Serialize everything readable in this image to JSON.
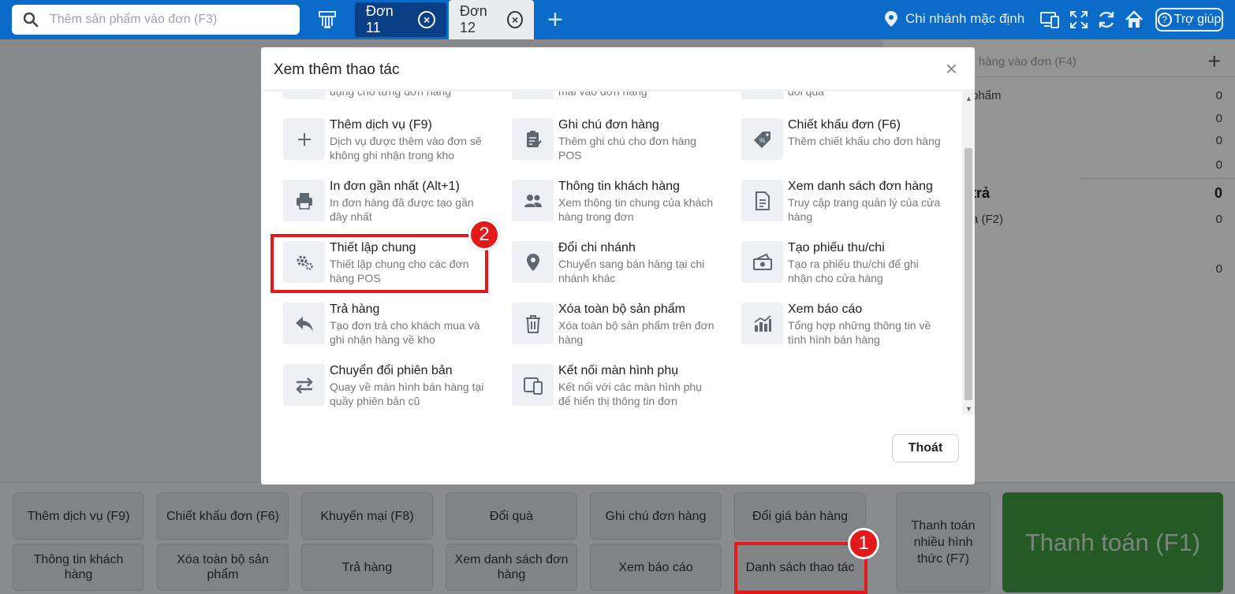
{
  "topbar": {
    "search_placeholder": "Thêm sản phẩm vào đơn (F3)",
    "tabs": [
      {
        "label": "Đơn 11"
      },
      {
        "label": "Đơn 12"
      }
    ],
    "add_tab": "+",
    "branch": "Chi nhánh mặc định",
    "help": "Trợ giúp",
    "icons": [
      "search-icon",
      "barcode-icon",
      "close-icon",
      "plus-icon",
      "location-pin-icon",
      "devices-icon",
      "fullscreen-icon",
      "refresh-icon",
      "home-icon",
      "help-icon"
    ]
  },
  "right_panel": {
    "customer_placeholder": "nh hàng vào đơn (F4)",
    "plus": "+",
    "rows": [
      {
        "label": "phẩm",
        "value": "0"
      },
      {
        "label": "",
        "value": "0"
      },
      {
        "label": "",
        "value": "0"
      },
      {
        "label": ")",
        "value": "0"
      },
      {
        "label": "trả",
        "value": "0"
      },
      {
        "label": "a (F2)",
        "value": "0"
      },
      {
        "label": "",
        "value": "0"
      }
    ]
  },
  "modal": {
    "title": "Xem thêm thao tác",
    "close": "×",
    "cutoff_descriptions": [
      "dụng cho từng đơn hàng",
      "mãi vào đơn hàng",
      "đổi quà"
    ],
    "actions": [
      {
        "title": "Thêm dịch vụ (F9)",
        "desc": "Dịch vụ được thêm vào đơn sẽ không ghi nhận trong kho",
        "icon": "plus-icon"
      },
      {
        "title": "Ghi chú đơn hàng",
        "desc": "Thêm ghi chú cho đơn hàng POS",
        "icon": "clipboard-note-icon"
      },
      {
        "title": "Chiết khấu đơn (F6)",
        "desc": "Thêm chiết khấu cho đơn hàng",
        "icon": "discount-tag-icon"
      },
      {
        "title": "In đơn gần nhất (Alt+1)",
        "desc": "In đơn hàng đã được tạo gần đây nhất",
        "icon": "printer-icon"
      },
      {
        "title": "Thông tin khách hàng",
        "desc": "Xem thông tin chung của khách hàng trong đơn",
        "icon": "users-icon"
      },
      {
        "title": "Xem danh sách đơn hàng",
        "desc": "Truy cập trang quản lý của cửa hàng",
        "icon": "document-list-icon"
      },
      {
        "title": "Thiết lập chung",
        "desc": "Thiết lập chung cho các đơn hàng POS",
        "icon": "gears-icon"
      },
      {
        "title": "Đổi chi nhánh",
        "desc": "Chuyển sang bán hàng tại chi nhánh khác",
        "icon": "location-pin-icon"
      },
      {
        "title": "Tạo phiếu thu/chi",
        "desc": "Tạo ra phiếu thu/chi để ghi nhận cho cửa hàng",
        "icon": "cash-icon"
      },
      {
        "title": "Trả hàng",
        "desc": "Tạo đơn trả cho khách mua và ghi nhận hàng về kho",
        "icon": "reply-arrow-icon"
      },
      {
        "title": "Xóa toàn bộ sản phẩm",
        "desc": "Xóa toàn bộ sản phẩm trên đơn hàng",
        "icon": "trash-icon"
      },
      {
        "title": "Xem báo cáo",
        "desc": "Tổng hợp những thông tin về tình hình bán hàng",
        "icon": "bar-chart-icon"
      },
      {
        "title": "Chuyển đổi phiên bản",
        "desc": "Quay về màn hình bán hàng tại quầy phiên bản cũ",
        "icon": "swap-arrows-icon"
      },
      {
        "title": "Kết nối màn hình phụ",
        "desc": "Kết nối với các màn hình phụ để hiển thị thông tin đơn",
        "icon": "monitor-devices-icon"
      }
    ],
    "exit": "Thoát"
  },
  "bottom": {
    "buttons_row1": [
      "Thêm dịch vụ (F9)",
      "Chiết khấu đơn (F6)",
      "Khuyến mại (F8)",
      "Đổi quà",
      "Ghi chú đơn hàng",
      "Đổi giá bán hàng"
    ],
    "buttons_row2": [
      "Thông tin khách hàng",
      "Xóa toàn bộ sản phẩm",
      "Trả hàng",
      "Xem danh sách đơn hàng",
      "Xem báo cáo",
      "Danh sách thao tác"
    ],
    "multi_pay": "Thanh toán nhiều hình thức (F7)",
    "pay": "Thanh toán (F1)"
  },
  "annotations": {
    "badge1": "1",
    "badge2": "2",
    "color": "#e3191c"
  }
}
